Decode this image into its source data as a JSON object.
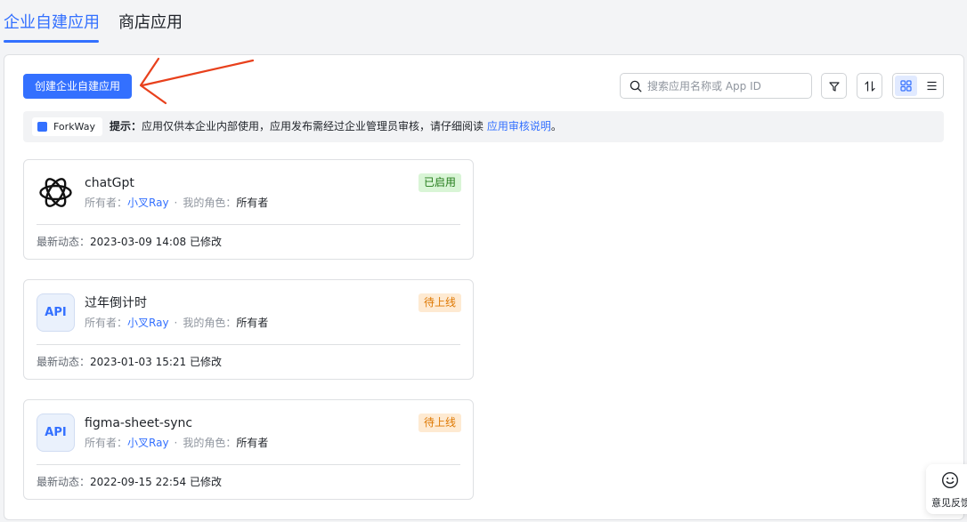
{
  "tabs": [
    {
      "label": "企业自建应用",
      "active": true
    },
    {
      "label": "商店应用",
      "active": false
    }
  ],
  "toolbar": {
    "create_label": "创建企业自建应用",
    "search_placeholder": "搜索应用名称或 App ID",
    "icons": {
      "search": "search-icon",
      "filter": "filter-icon",
      "sort": "sort-icon",
      "grid": "grid-view-icon",
      "list": "list-view-icon"
    },
    "active_view": "grid"
  },
  "notice": {
    "brand": "ForkWay",
    "title": "提示：",
    "text": "应用仅供本企业内部使用，应用发布需经过企业管理员审核，请仔细阅读 ",
    "link": "应用审核说明",
    "end": "。"
  },
  "labels": {
    "owner": "所有者：",
    "role": "我的角色：",
    "activity": "最新动态："
  },
  "apps": [
    {
      "name": "chatGpt",
      "icon": "chatgpt-logo-icon",
      "owner": "小叉Ray",
      "role": "所有者",
      "status": "已启用",
      "status_type": "enabled",
      "updated_at": "2023-03-09 14:08",
      "action": "已修改"
    },
    {
      "name": "过年倒计时",
      "icon": "api-icon",
      "owner": "小叉Ray",
      "role": "所有者",
      "status": "待上线",
      "status_type": "pending",
      "updated_at": "2023-01-03 15:21",
      "action": "已修改"
    },
    {
      "name": "figma-sheet-sync",
      "icon": "api-icon",
      "owner": "小叉Ray",
      "role": "所有者",
      "status": "待上线",
      "status_type": "pending",
      "updated_at": "2022-09-15 22:54",
      "action": "已修改"
    }
  ],
  "api_icon_text": "API",
  "feedback": {
    "label": "意见反馈",
    "icon": "smile-icon"
  },
  "colors": {
    "accent": "#3370ff",
    "arrow": "#e8401c",
    "enabled_bg": "#d9f5d6",
    "enabled_fg": "#237b19",
    "pending_bg": "#feead2",
    "pending_fg": "#de7802"
  }
}
